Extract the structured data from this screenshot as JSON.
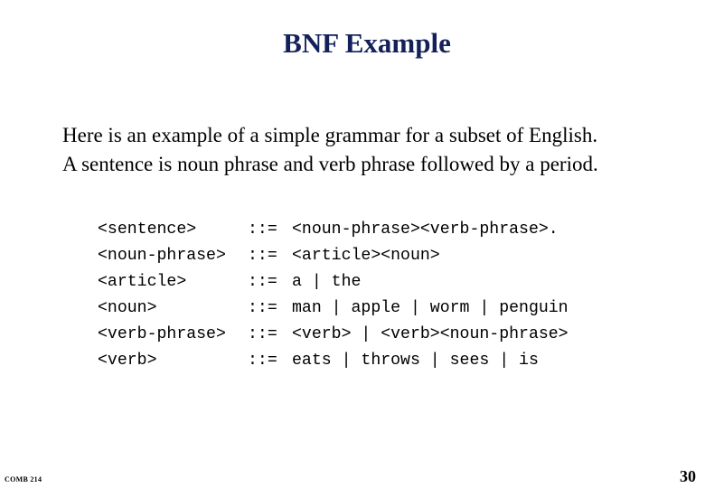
{
  "slide": {
    "title": "BNF Example",
    "intro": [
      "Here is an example of a simple grammar for a subset of English.",
      "A sentence is noun phrase and verb phrase followed by a period."
    ],
    "grammar": [
      {
        "lhs": "<sentence>",
        "op": "::=",
        "rhs": "<noun-phrase><verb-phrase>."
      },
      {
        "lhs": "<noun-phrase>",
        "op": "::=",
        "rhs": "<article><noun>"
      },
      {
        "lhs": "<article>",
        "op": "::=",
        "rhs": "a | the"
      },
      {
        "lhs": "<noun>",
        "op": "::=",
        "rhs": "man | apple | worm | penguin"
      },
      {
        "lhs": "<verb-phrase>",
        "op": "::=",
        "rhs": "<verb> | <verb><noun-phrase>"
      },
      {
        "lhs": "<verb>",
        "op": "::=",
        "rhs": "eats | throws | sees | is"
      }
    ],
    "footer": {
      "course": "COMB 214",
      "page_number": "30"
    },
    "colors": {
      "title": "#13215a",
      "text": "#000000",
      "background": "#ffffff"
    }
  }
}
